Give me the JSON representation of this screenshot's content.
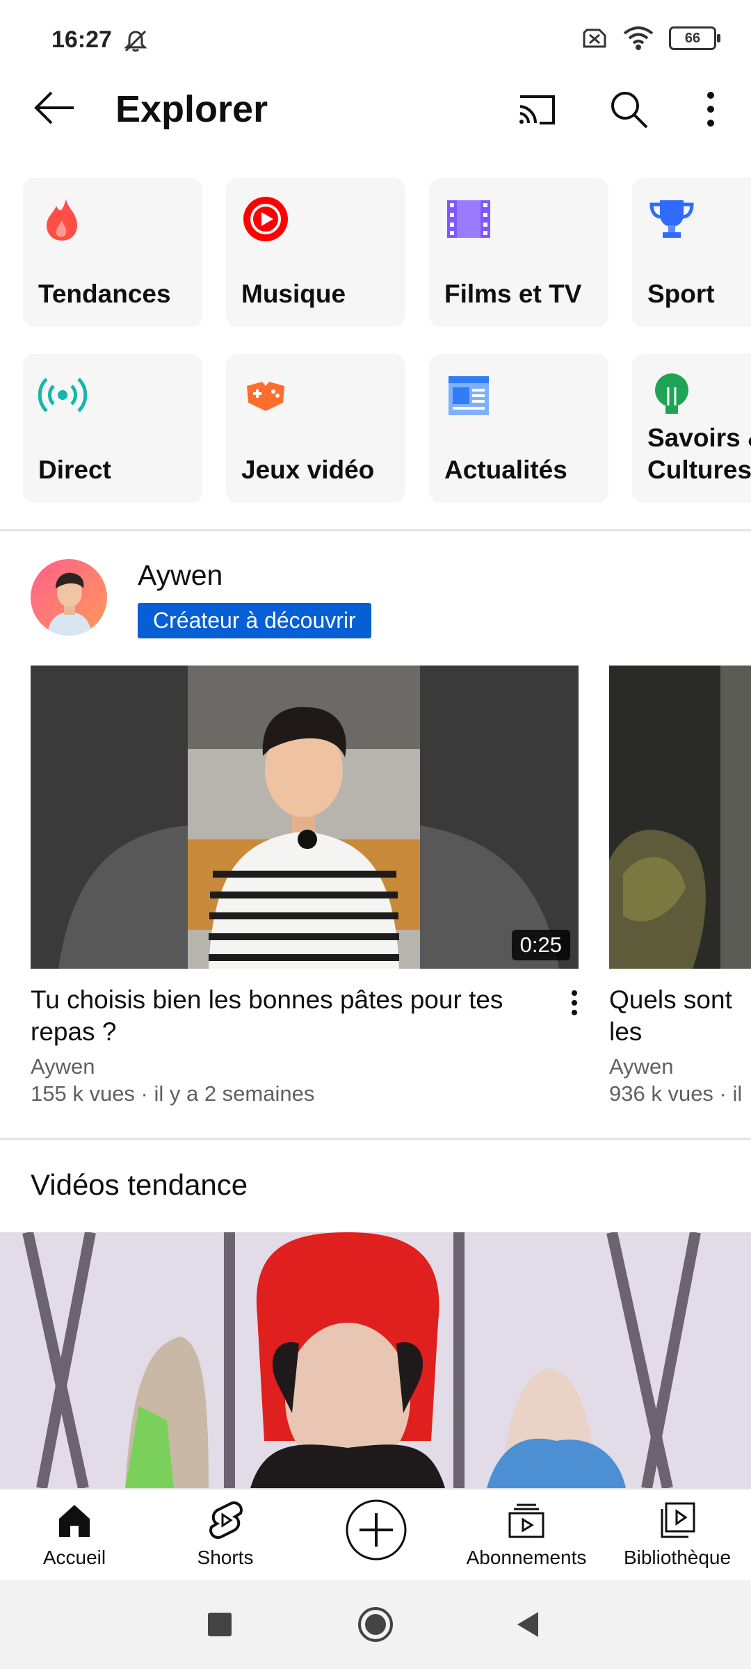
{
  "status_bar": {
    "time": "16:27",
    "battery": "66"
  },
  "header": {
    "title": "Explorer",
    "icons": [
      "back-arrow-icon",
      "cast-icon",
      "search-icon",
      "more-vert-icon"
    ]
  },
  "categories": [
    {
      "label": "Tendances",
      "icon": "trending-flame-icon",
      "color": "#ff4e45"
    },
    {
      "label": "Musique",
      "icon": "music-play-icon",
      "color": "#ff0000"
    },
    {
      "label": "Films et TV",
      "icon": "film-strip-icon",
      "color": "#7e57ff"
    },
    {
      "label": "Sport",
      "icon": "trophy-icon",
      "color": "#2f6bff"
    },
    {
      "label": "Direct",
      "icon": "live-broadcast-icon",
      "color": "#13b8a8"
    },
    {
      "label": "Jeux vidéo",
      "icon": "gamepad-icon",
      "color": "#ff6d2e"
    },
    {
      "label": "Actualités",
      "icon": "newspaper-icon",
      "color": "#2f7cf6"
    },
    {
      "label": "Savoirs & Cultures",
      "icon": "lightbulb-icon",
      "color": "#1fa354"
    }
  ],
  "creator": {
    "name": "Aywen",
    "badge": "Créateur à découvrir"
  },
  "videos": [
    {
      "title": "Tu choisis bien les bonnes pâtes pour tes repas ?",
      "channel": "Aywen",
      "meta": "155 k vues · il y a 2 semaines",
      "duration": "0:25"
    },
    {
      "title": "Quels sont les présidents F",
      "channel": "Aywen",
      "meta": "936 k vues · il"
    }
  ],
  "trending": {
    "title": "Vidéos tendance"
  },
  "bottom_nav": [
    {
      "label": "Accueil",
      "icon": "home-icon"
    },
    {
      "label": "Shorts",
      "icon": "shorts-icon"
    },
    {
      "label": "",
      "icon": "create-plus-icon"
    },
    {
      "label": "Abonnements",
      "icon": "subscriptions-icon"
    },
    {
      "label": "Bibliothèque",
      "icon": "library-icon"
    }
  ]
}
